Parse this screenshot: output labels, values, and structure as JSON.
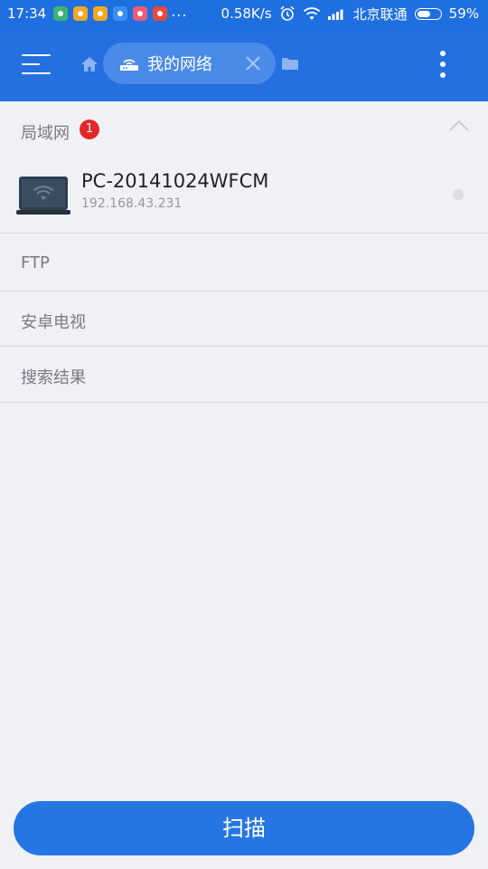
{
  "status_bar": {
    "time": "17:34",
    "app_icons": [
      {
        "name": "app-notification-icon-1",
        "color": "#3cb371"
      },
      {
        "name": "app-notification-icon-2",
        "color": "#f5a623"
      },
      {
        "name": "app-notification-icon-3",
        "color": "#f5a623"
      },
      {
        "name": "app-notification-icon-4",
        "color": "#3a8ef0"
      },
      {
        "name": "app-notification-icon-5",
        "color": "#e85d75"
      },
      {
        "name": "app-notification-icon-6",
        "color": "#e84a3c"
      }
    ],
    "more": "...",
    "speed": "0.58K/s",
    "carrier": "北京联通",
    "battery": "59%",
    "battery_level": 0.59
  },
  "app_bar": {
    "tab_label": "我的网络",
    "menu_icon": "menu-icon",
    "home_icon": "home-icon",
    "close_icon": "close-icon",
    "overflow_icon": "more-vert-icon"
  },
  "sections": {
    "lan": {
      "title": "局域网",
      "badge": "1",
      "devices": [
        {
          "name": "PC-20141024WFCM",
          "ip": "192.168.43.231"
        }
      ]
    },
    "ftp": {
      "title": "FTP"
    },
    "android_tv": {
      "title": "安卓电视"
    },
    "search_results": {
      "title": "搜索结果"
    }
  },
  "scan_button": {
    "label": "扫描"
  },
  "colors": {
    "primary": "#2470e0",
    "badge": "#e4272b",
    "background": "#eff1f5"
  }
}
